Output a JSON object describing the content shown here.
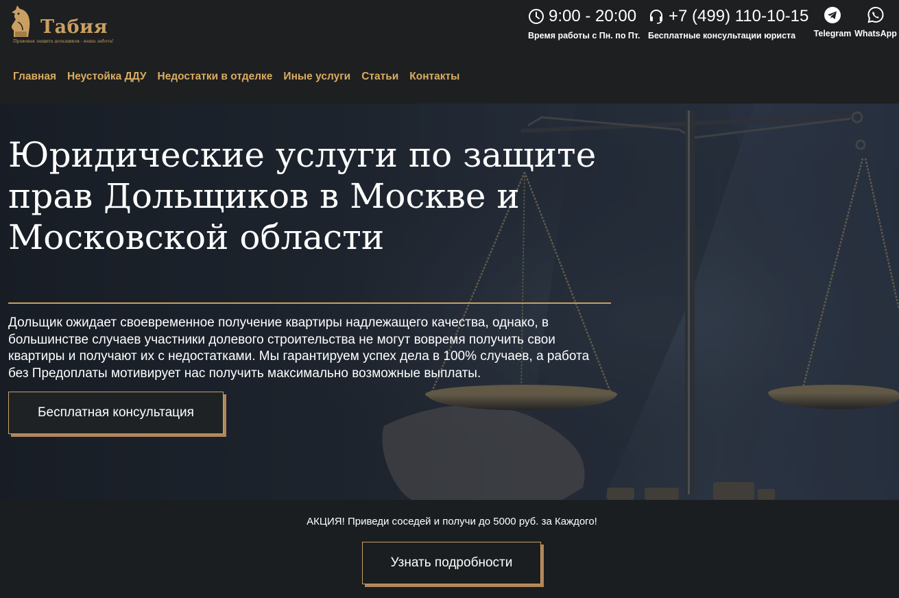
{
  "brand": {
    "name": "Табия",
    "tagline": "Правовая защита дольщиков - наша забота!",
    "color": "#c9a062"
  },
  "contacts": {
    "hours": {
      "icon": "clock-icon",
      "value": "9:00 - 20:00",
      "caption": "Время работы с Пн. по Пт."
    },
    "phone": {
      "icon": "headset-icon",
      "value": "+7 (499) 110-10-15",
      "caption": "Бесплатные консультации юриста"
    },
    "telegram": {
      "icon": "telegram-icon",
      "label": "Telegram"
    },
    "whatsapp": {
      "icon": "whatsapp-icon",
      "label": "WhatsApp"
    }
  },
  "nav": {
    "items": [
      "Главная",
      "Неустойка ДДУ",
      "Недостатки в отделке",
      "Иные услуги",
      "Статьи",
      "Контакты"
    ],
    "color": "#d9ad62"
  },
  "hero": {
    "title": "Юридические услуги по защите прав Дольщиков в Москве и Московской области",
    "text": "Дольщик ожидает своевременное получение квартиры надлежащего качества, однако, в большинстве случаев участники долевого строительства не могут вовремя получить свои квартиры и получают их с недостатками. Мы гарантируем успех дела в 100% случаев, а работа без Предоплаты мотивирует нас получить максимально возможные выплаты.",
    "button": "Бесплатная консультация"
  },
  "promo": {
    "text": "АКЦИЯ! Приведи соседей и получи до 5000 руб. за Каждого!",
    "button": "Узнать подробности"
  }
}
